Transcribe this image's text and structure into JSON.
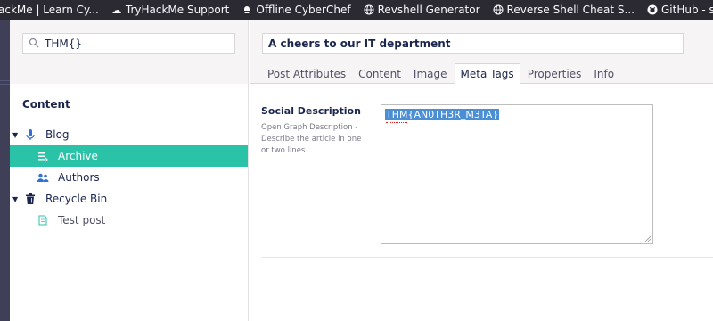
{
  "bookmarks": [
    {
      "label": "ackMe | Learn Cy...",
      "icon": "tryhackme-icon"
    },
    {
      "label": "TryHackMe Support",
      "icon": "cloud-icon"
    },
    {
      "label": "Offline CyberChef",
      "icon": "chef-icon"
    },
    {
      "label": "Revshell Generator",
      "icon": "globe-icon"
    },
    {
      "label": "Reverse Shell Cheat S...",
      "icon": "globe-icon"
    },
    {
      "label": "GitHub - swisskyrepo/...",
      "icon": "github-icon"
    }
  ],
  "tree": {
    "search_value": "THM{}",
    "section_title": "Content",
    "nodes": [
      {
        "label": "Blog",
        "icon": "microphone-icon",
        "expandable": true
      },
      {
        "label": "Archive",
        "icon": "list-icon",
        "selected": true
      },
      {
        "label": "Authors",
        "icon": "users-icon"
      },
      {
        "label": "Recycle Bin",
        "icon": "trash-icon",
        "expandable": true
      },
      {
        "label": "Test post",
        "icon": "document-icon",
        "muted": true
      }
    ]
  },
  "editor": {
    "name_value": "A cheers to our IT department",
    "tabs": [
      "Post Attributes",
      "Content",
      "Image",
      "Meta Tags",
      "Properties",
      "Info"
    ],
    "active_tab": "Meta Tags",
    "property": {
      "label": "Social Description",
      "description": "Open Graph Description - Describe the article in one or two lines.",
      "value": "THM{AN0TH3R_M3TA}"
    }
  },
  "colors": {
    "accent": "#2bc3a8",
    "text": "#1b264f",
    "bookmarks_bg": "#2b2a33",
    "selection": "#4a8fd6"
  }
}
